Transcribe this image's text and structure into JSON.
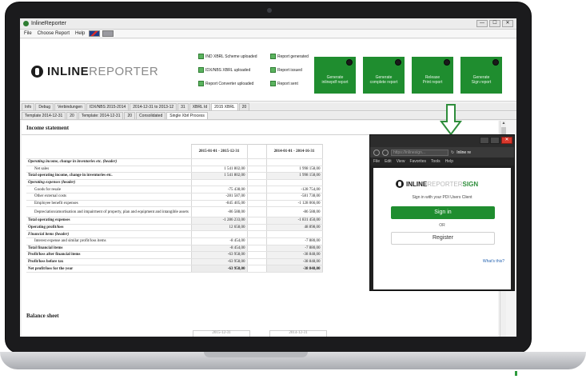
{
  "window": {
    "title": "InlineReporter",
    "controls": [
      "—",
      "☐",
      "✕"
    ]
  },
  "menu": {
    "items": [
      "File",
      "Choose Report",
      "Help"
    ]
  },
  "brand": {
    "strong": "INLINE",
    "light": "REPORTER"
  },
  "checks": [
    {
      "label": "IND XBRL Scheme uploaded"
    },
    {
      "label": "Report generated"
    },
    {
      "label": "IDX/NBS XBRL uploaded"
    },
    {
      "label": "Report issued"
    },
    {
      "label": "Report Converter uploaded"
    },
    {
      "label": "Report sent"
    }
  ],
  "actions": [
    {
      "title": "Generate",
      "sub": "inlinepdf report"
    },
    {
      "title": "Generate",
      "sub": "complete report"
    },
    {
      "title": "Release",
      "sub": "Print report"
    },
    {
      "title": "Generate",
      "sub": "Sign report"
    }
  ],
  "tabs_row1": [
    "Info",
    "Debug",
    "Verbindungen",
    "IDX/NBS 2015-2014",
    "2014-12-31 to 2013-12",
    "31",
    "XBRL Id",
    "2015 XBRL",
    "20"
  ],
  "tabs_row2": [
    "Template 2014-12-31",
    "20",
    "Template: 2014-12-31",
    "20",
    "Consolidated",
    "Single Xbrl Process"
  ],
  "income": {
    "title": "Income statement",
    "col1": "2015-01-01 - 2015-12-31",
    "col2": "2014-01-01 - 2014-16-31",
    "rows": [
      {
        "label": "Operating income, change in inventories etc. (header)",
        "v1": "",
        "v2": ""
      },
      {
        "label": "Net sales",
        "v1": "1 541 802,00",
        "v2": "1 998 158,00"
      },
      {
        "label": "Total operating income, change in inventories etc.",
        "v1": "1 541 802,00",
        "v2": "1 998 158,00"
      },
      {
        "label": "Operating expenses (header)",
        "v1": "",
        "v2": ""
      },
      {
        "label": "Goods for resale",
        "v1": "-75 438,00",
        "v2": "-128 754,00"
      },
      {
        "label": "Other external costs",
        "v1": "-281 587,00",
        "v2": "-581 738,00"
      },
      {
        "label": "Employee benefit expenses",
        "v1": "-845 405,00",
        "v2": "-1 128 066,00"
      },
      {
        "label": "Depreciation/amortisation and impairment of property, plan and equipment and intangible assets",
        "v1": "-86 588,00",
        "v2": "-86 588,00"
      },
      {
        "label": "Total operating expenses",
        "v1": "-1 286 233,00",
        "v2": "-1 831 450,00"
      },
      {
        "label": "Operating profit/loss",
        "v1": "12 658,00",
        "v2": "48 898,00"
      },
      {
        "label": "Financial items (header)",
        "v1": "",
        "v2": ""
      },
      {
        "label": "Interest expense and similar profit/loss items",
        "v1": "-8 454,00",
        "v2": "-7 880,00"
      },
      {
        "label": "Total financial items",
        "v1": "-8 454,00",
        "v2": "-7 880,00"
      },
      {
        "label": "Profit/loss after financial items",
        "v1": "-63 958,00",
        "v2": "-38 848,00"
      },
      {
        "label": "Profit/loss before tax",
        "v1": "-63 958,00",
        "v2": "-38 848,00"
      },
      {
        "label": "Net profit/loss for the year",
        "v1": "-63 958,00",
        "v2": "-38 848,00"
      }
    ]
  },
  "balance": {
    "title": "Balance sheet",
    "col1": "2015-12-31",
    "col2": "2014-12-31"
  },
  "popup": {
    "url": "https://inlinesign...",
    "tab": "Inline re",
    "menu": [
      "File",
      "Edit",
      "View",
      "Favorites",
      "Tools",
      "Help"
    ],
    "brand_strong": "INLINE",
    "brand_light": "REPORTER",
    "brand_accent": "SIGN",
    "intro": "Sign in with your PDI Users Client",
    "signin": "Sign in",
    "or": "OR",
    "register": "Register",
    "whats": "What's this?"
  },
  "colors": {
    "brand_green": "#1f8d2f",
    "laptop_bezel": "#1b1b1d",
    "close_red": "#d9382c"
  },
  "icons": [
    "app-logo-icon",
    "action-icon",
    "close-icon",
    "arrow-down-icon",
    "refresh-icon"
  ]
}
